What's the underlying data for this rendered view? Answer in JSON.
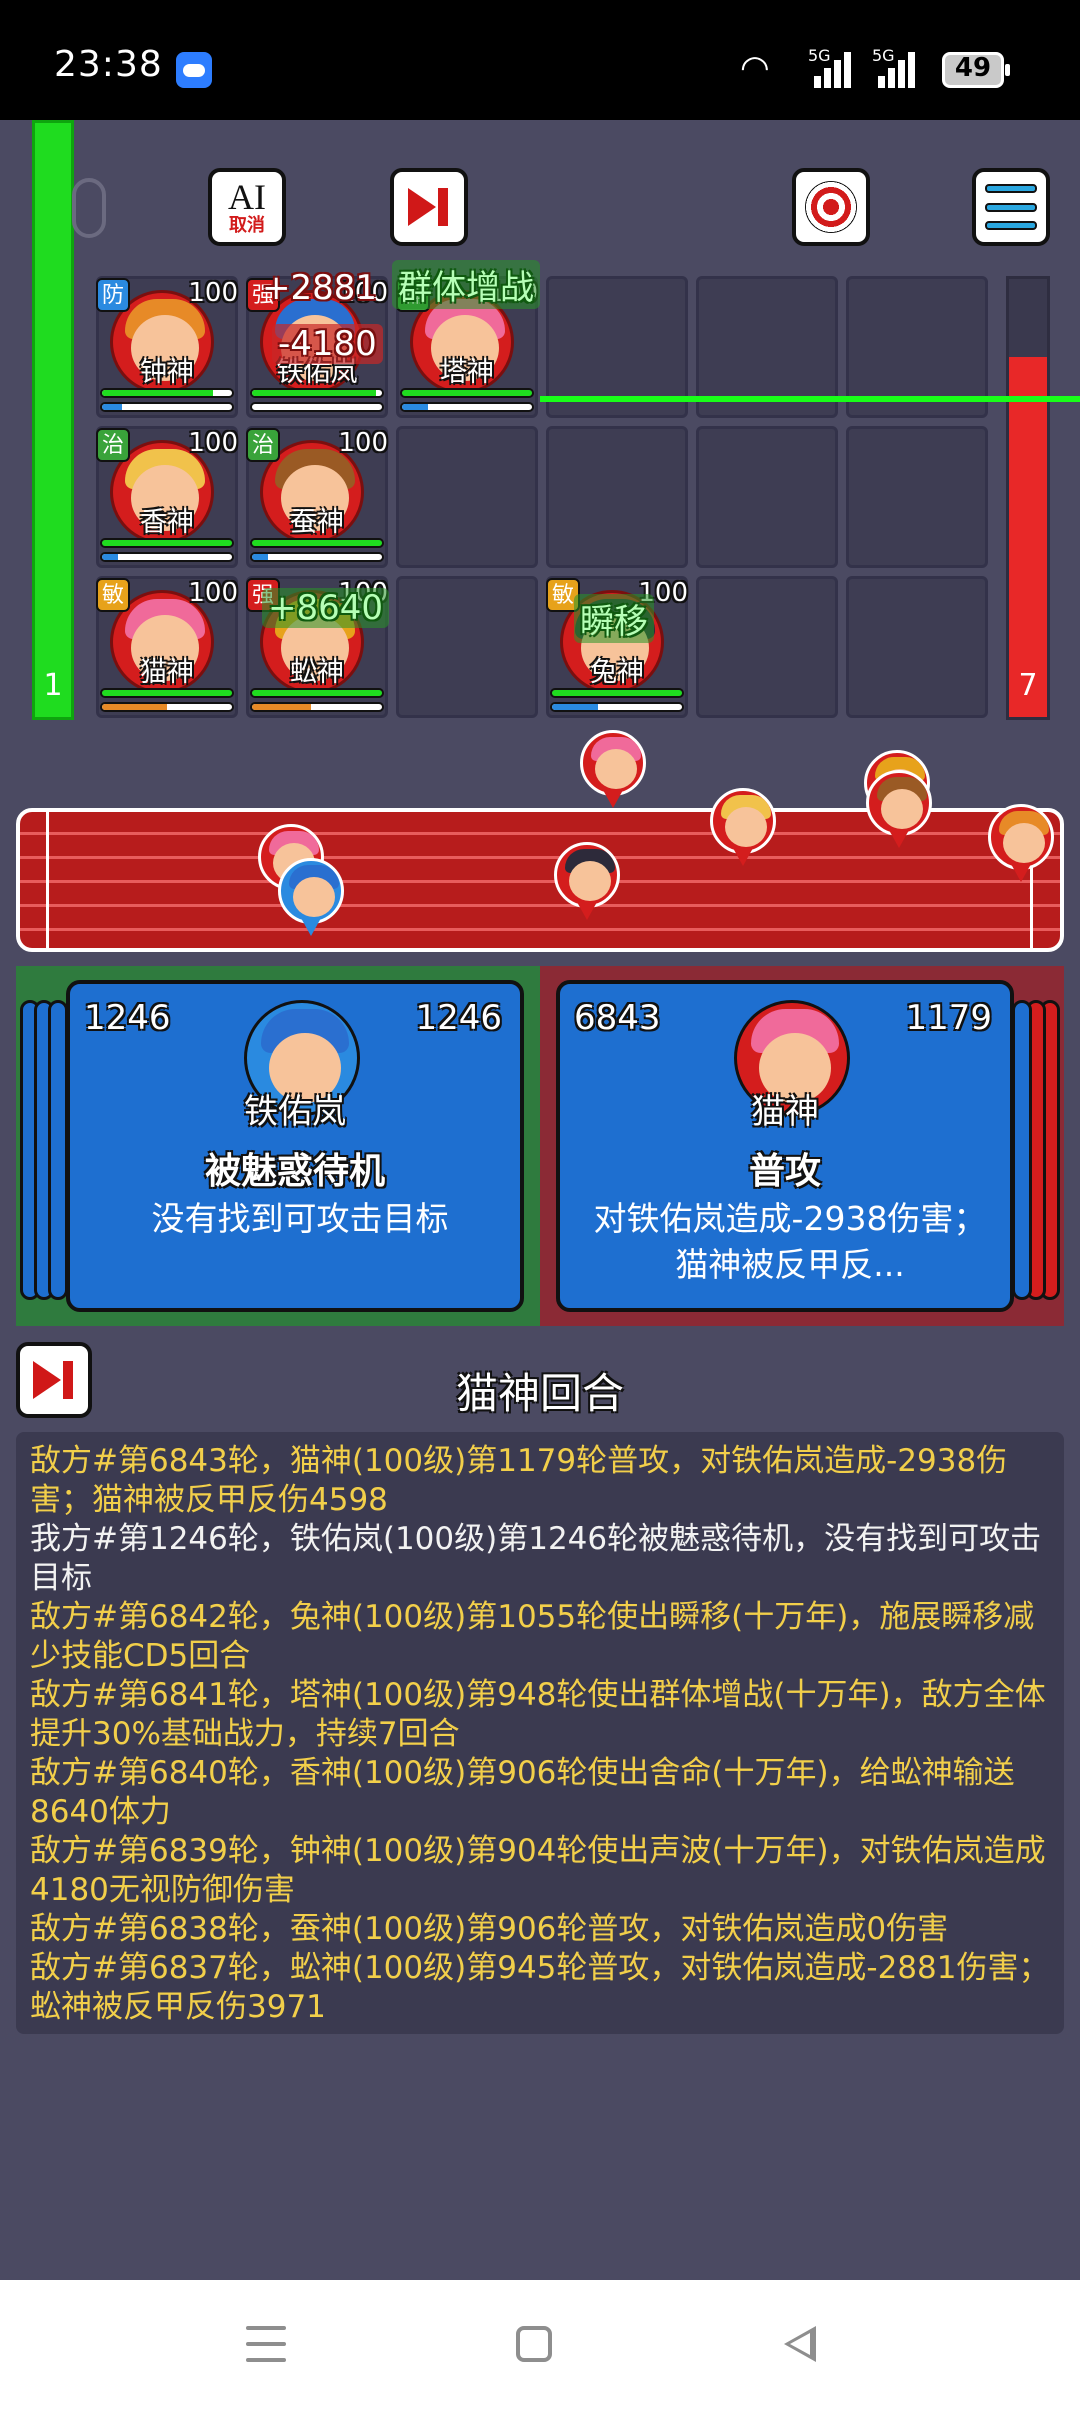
{
  "status": {
    "time": "23:38",
    "battery": "49",
    "network1": "5G",
    "network2": "5G"
  },
  "toolbar": {
    "ai_label": "AI",
    "cancel_label": "取消"
  },
  "left_team_count": "1",
  "right_team_count": "7",
  "grid": [
    {
      "id": "c1",
      "name": "钟神",
      "level": "100",
      "tag": "防",
      "tag_color": "#2a8ae0",
      "hair": "#e78a27",
      "hp": 0.85,
      "mp": 0.15,
      "mp_color": "#2a8ae0"
    },
    {
      "id": "c2",
      "name": "铁佑岚",
      "level": "100",
      "tag": "强",
      "tag_color": "#d41d1d",
      "hair": "#2a6fd0",
      "hp": 0.95,
      "mp": 0.0,
      "mp_color": "#2a8ae0"
    },
    {
      "id": "c3",
      "name": "塔神",
      "level": "100",
      "tag": "辅",
      "tag_color": "#39a33a",
      "hair": "#f06a9a",
      "hp": 1.0,
      "mp": 0.2,
      "mp_color": "#2a8ae0"
    },
    {
      "id": "c4",
      "name": "香神",
      "level": "100",
      "tag": "治",
      "tag_color": "#39a33a",
      "hair": "#f1c24b",
      "hp": 1.0,
      "mp": 0.12,
      "mp_color": "#2a8ae0"
    },
    {
      "id": "c5",
      "name": "蚕神",
      "level": "100",
      "tag": "治",
      "tag_color": "#39a33a",
      "hair": "#9a5a24",
      "hp": 1.0,
      "mp": 0.12,
      "mp_color": "#2a8ae0"
    },
    {
      "id": "c6",
      "name": "猫神",
      "level": "100",
      "tag": "敏",
      "tag_color": "#e7a21b",
      "hair": "#f06a9a",
      "hp": 1.0,
      "mp": 0.5,
      "mp_color": "#e78a27"
    },
    {
      "id": "c7",
      "name": "蚣神",
      "level": "100",
      "tag": "强",
      "tag_color": "#d41d1d",
      "hair": "#e7a21b",
      "hp": 1.0,
      "mp": 0.45,
      "mp_color": "#e78a27"
    },
    {
      "id": "c8",
      "name": "兔神",
      "level": "100",
      "tag": "敏",
      "tag_color": "#e7a21b",
      "hair": "#2d2a3a",
      "hp": 1.0,
      "mp": 0.35,
      "mp_color": "#2a8ae0"
    }
  ],
  "floats": {
    "dmg1": "+2881",
    "dmg2": "-4180",
    "buff1": "群体增战",
    "heal1": "+8640",
    "skill1": "瞬移"
  },
  "card_left": {
    "round": "1246",
    "speed": "1246",
    "name": "铁佑岚",
    "action": "被魅惑待机",
    "desc": "没有找到可攻击目标",
    "color": "#1e6fd0"
  },
  "card_right": {
    "round": "6843",
    "speed": "1179",
    "name": "猫神",
    "action": "普攻",
    "desc": "对铁佑岚造成-2938伤害；猫神被反甲反...",
    "color": "#1e6fd0"
  },
  "round_title": "猫神回合",
  "log": [
    {
      "side": "enemy",
      "text": "敌方#第6843轮，猫神(100级)第1179轮普攻，对铁佑岚造成-2938伤害；猫神被反甲反伤4598"
    },
    {
      "side": "mine",
      "text": "我方#第1246轮，铁佑岚(100级)第1246轮被魅惑待机，没有找到可攻击目标"
    },
    {
      "side": "enemy",
      "text": "敌方#第6842轮，兔神(100级)第1055轮使出瞬移(十万年)，施展瞬移减少技能CD5回合"
    },
    {
      "side": "enemy",
      "text": "敌方#第6841轮，塔神(100级)第948轮使出群体增战(十万年)，敌方全体提升30%基础战力，持续7回合"
    },
    {
      "side": "enemy",
      "text": "敌方#第6840轮，香神(100级)第906轮使出舍命(十万年)，给蚣神输送8640体力"
    },
    {
      "side": "enemy",
      "text": "敌方#第6839轮，钟神(100级)第904轮使出声波(十万年)，对铁佑岚造成4180无视防御伤害"
    },
    {
      "side": "enemy",
      "text": "敌方#第6838轮，蚕神(100级)第906轮普攻，对铁佑岚造成0伤害"
    },
    {
      "side": "enemy",
      "text": "敌方#第6837轮，蚣神(100级)第945轮普攻，对铁佑岚造成-2881伤害；蚣神被反甲反伤3971"
    }
  ]
}
